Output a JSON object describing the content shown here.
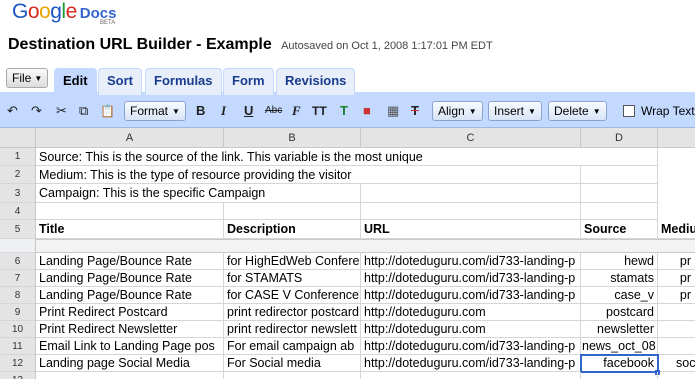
{
  "header": {
    "logo_google": [
      "G",
      "o",
      "o",
      "g",
      "l",
      "e"
    ],
    "logo_docs": "Docs",
    "logo_beta": "BETA",
    "doc_title": "Destination URL Builder - Example",
    "autosaved": "Autosaved on Oct 1, 2008 1:17:01 PM EDT"
  },
  "menu": {
    "file": "File"
  },
  "tabs": [
    "Edit",
    "Sort",
    "Formulas",
    "Form",
    "Revisions"
  ],
  "toolbar": {
    "undo": "↶",
    "redo": "↷",
    "cut": "✂",
    "copy": "⧉",
    "paste": "📋",
    "format": "Format",
    "bold": "B",
    "italic": "I",
    "underline": "U",
    "strike": "Abc",
    "font": "F",
    "font_size": "TT",
    "text_color": "T",
    "bg_color": "■",
    "borders": "▦",
    "clear": "T",
    "align": "Align",
    "insert": "Insert",
    "delete": "Delete",
    "wrap_text": "Wrap Text"
  },
  "grid": {
    "columns": [
      "A",
      "B",
      "C",
      "D",
      ""
    ],
    "row_numbers": [
      "1",
      "2",
      "3",
      "4",
      "5",
      "6",
      "7",
      "8",
      "9",
      "10",
      "11",
      "12",
      "13"
    ],
    "notes": [
      "Source: This is the source of the link. This variable is the most unique",
      "Medium: This is the type of resource providing the visitor",
      "Campaign: This is the specific Campaign"
    ],
    "headers": [
      "Title",
      "Description",
      "URL",
      "Source",
      "Mediu"
    ],
    "rows": [
      [
        "Landing Page/Bounce Rate",
        "for HighEdWeb Confere",
        "http://doteduguru.com/id733-landing-p",
        "hewd",
        "pr"
      ],
      [
        "Landing Page/Bounce Rate",
        "for STAMATS",
        "http://doteduguru.com/id733-landing-p",
        "stamats",
        "pr"
      ],
      [
        "Landing Page/Bounce Rate",
        "for CASE V Conference",
        "http://doteduguru.com/id733-landing-p",
        "case_v",
        "pr"
      ],
      [
        "Print Redirect Postcard",
        "print redirector postcard",
        "http://doteduguru.com",
        "postcard",
        ""
      ],
      [
        "Print Redirect Newsletter",
        "print redirector newslett",
        "http://doteduguru.com",
        "newsletter",
        ""
      ],
      [
        "Email Link to Landing Page pos",
        "For email campaign ab",
        "http://doteduguru.com/id733-landing-p",
        "news_oct_08",
        ""
      ],
      [
        "Landing page Social Media",
        "For Social media",
        "http://doteduguru.com/id733-landing-p",
        "facebook",
        "soc"
      ]
    ]
  },
  "colors": {
    "toolbar_bg": "#c3d9ff",
    "tab_text": "#1a3c8e",
    "selection": "#3366cc"
  }
}
